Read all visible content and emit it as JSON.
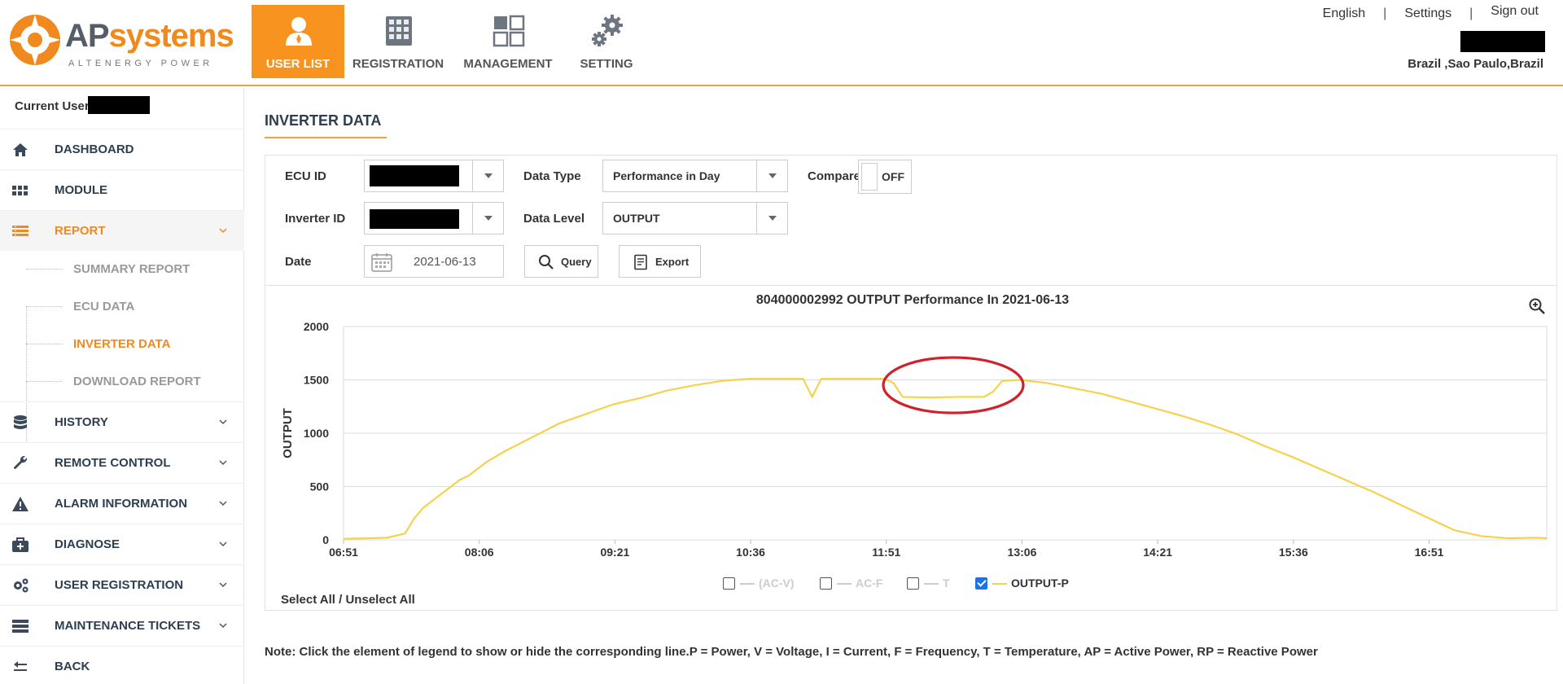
{
  "header": {
    "logo": {
      "word_ap": "AP",
      "word_systems": "systems",
      "tagline": "ALTENERGY POWER"
    },
    "nav": [
      {
        "label": "USER LIST",
        "icon": "user-icon",
        "active": true
      },
      {
        "label": "REGISTRATION",
        "icon": "solar-panel-icon",
        "active": false
      },
      {
        "label": "MANAGEMENT",
        "icon": "grid-icon",
        "active": false
      },
      {
        "label": "SETTING",
        "icon": "gears-icon",
        "active": false
      }
    ],
    "top_links": {
      "language": "English",
      "settings": "Settings",
      "sign_out": "Sign out",
      "separator": "|"
    },
    "location": "Brazil ,Sao Paulo,Brazil"
  },
  "sidebar": {
    "current_user_label": "Current User:",
    "items": [
      {
        "label": "DASHBOARD",
        "icon": "home-icon"
      },
      {
        "label": "MODULE",
        "icon": "module-grid-icon"
      },
      {
        "label": "REPORT",
        "icon": "report-icon",
        "open": true,
        "children": [
          {
            "label": "SUMMARY REPORT",
            "active": false
          },
          {
            "label": "ECU DATA",
            "active": false
          },
          {
            "label": "INVERTER DATA",
            "active": true
          },
          {
            "label": "DOWNLOAD REPORT",
            "active": false
          }
        ]
      },
      {
        "label": "HISTORY",
        "icon": "database-icon"
      },
      {
        "label": "REMOTE CONTROL",
        "icon": "wrench-icon"
      },
      {
        "label": "ALARM INFORMATION",
        "icon": "warning-icon"
      },
      {
        "label": "DIAGNOSE",
        "icon": "medkit-icon"
      },
      {
        "label": "USER REGISTRATION",
        "icon": "cogs-icon"
      },
      {
        "label": "MAINTENANCE TICKETS",
        "icon": "tickets-icon"
      },
      {
        "label": "BACK",
        "icon": "back-arrow-icon"
      }
    ]
  },
  "main": {
    "title": "INVERTER DATA",
    "form": {
      "ecu_id_label": "ECU ID",
      "inverter_id_label": "Inverter ID",
      "date_label": "Date",
      "date_value": "2021-06-13",
      "data_type_label": "Data Type",
      "data_type_value": "Performance in Day",
      "data_level_label": "Data Level",
      "data_level_value": "OUTPUT",
      "compare_label": "Compare",
      "compare_state": "OFF",
      "query_label": "Query",
      "export_label": "Export"
    },
    "select_all": "Select All / Unselect All",
    "note": "Note: Click the element of legend to show or hide the corresponding line.P = Power, V = Voltage, I = Current, F = Frequency, T = Temperature, AP = Active Power, RP = Reactive Power",
    "legend": [
      {
        "label": "(AC-V)",
        "checked": false
      },
      {
        "label": "AC-F",
        "checked": false
      },
      {
        "label": "T",
        "checked": false
      },
      {
        "label": "OUTPUT-P",
        "checked": true
      }
    ]
  },
  "colors": {
    "accent": "#f7931e",
    "line": "#f5d24c",
    "annotation": "#d0202a",
    "text_dark": "#2d3e50"
  },
  "chart_data": {
    "type": "line",
    "title": "804000002992 OUTPUT Performance In 2021-06-13",
    "xlabel": "",
    "ylabel": "OUTPUT",
    "x_tick_labels": [
      "06:51",
      "08:06",
      "09:21",
      "10:36",
      "11:51",
      "13:06",
      "14:21",
      "15:36",
      "16:51"
    ],
    "y_ticks": [
      0,
      500,
      1000,
      1500,
      2000
    ],
    "ylim": [
      0,
      2000
    ],
    "x_minutes_range": [
      "06:51",
      "17:56"
    ],
    "grid": true,
    "annotation": "red ellipse around the dip after 11:51",
    "series": [
      {
        "name": "OUTPUT-P",
        "x": [
          "06:51",
          "07:05",
          "07:15",
          "07:25",
          "07:30",
          "07:35",
          "07:45",
          "07:55",
          "08:00",
          "08:10",
          "08:20",
          "08:35",
          "08:50",
          "09:05",
          "09:20",
          "09:35",
          "09:50",
          "10:05",
          "10:20",
          "10:35",
          "10:50",
          "11:05",
          "11:10",
          "11:15",
          "11:20",
          "11:35",
          "11:50",
          "11:55",
          "12:00",
          "12:15",
          "12:30",
          "12:45",
          "12:50",
          "12:55",
          "13:05",
          "13:20",
          "13:35",
          "13:50",
          "14:05",
          "14:20",
          "14:35",
          "14:50",
          "15:05",
          "15:20",
          "15:35",
          "15:50",
          "16:05",
          "16:20",
          "16:35",
          "16:50",
          "17:05",
          "17:20",
          "17:35",
          "17:50",
          "17:56"
        ],
        "values": [
          10,
          15,
          20,
          60,
          200,
          300,
          430,
          560,
          600,
          730,
          830,
          960,
          1090,
          1180,
          1270,
          1330,
          1400,
          1450,
          1490,
          1510,
          1510,
          1510,
          1340,
          1510,
          1510,
          1510,
          1510,
          1470,
          1340,
          1335,
          1340,
          1340,
          1390,
          1490,
          1500,
          1470,
          1420,
          1370,
          1300,
          1230,
          1160,
          1080,
          990,
          880,
          780,
          670,
          560,
          450,
          330,
          210,
          90,
          35,
          15,
          20,
          15
        ]
      }
    ]
  }
}
